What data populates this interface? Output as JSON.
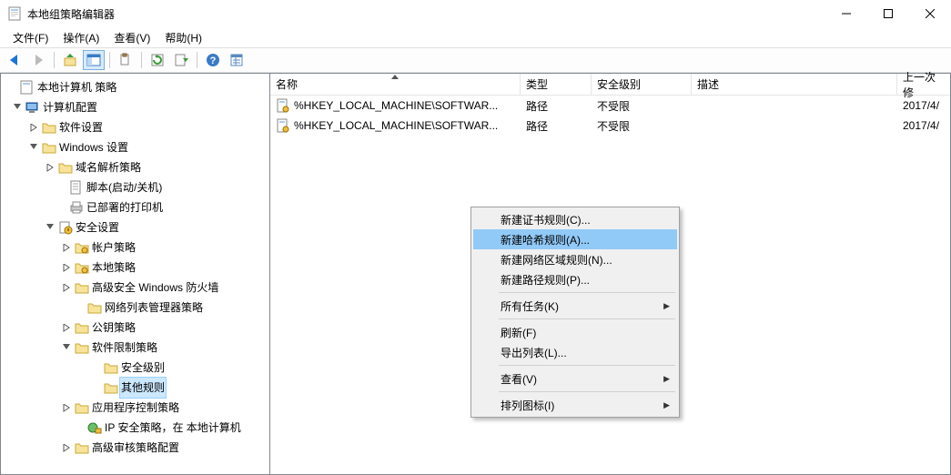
{
  "window": {
    "title": "本地组策略编辑器"
  },
  "menu": {
    "file": "文件(F)",
    "action": "操作(A)",
    "view": "查看(V)",
    "help": "帮助(H)"
  },
  "tree": {
    "root": "本地计算机 策略",
    "computer_config": "计算机配置",
    "software_settings": "软件设置",
    "windows_settings": "Windows 设置",
    "nrp": "域名解析策略",
    "scripts": "脚本(启动/关机)",
    "printers": "已部署的打印机",
    "security_settings": "安全设置",
    "account_policies": "帐户策略",
    "local_policies": "本地策略",
    "adv_firewall": "高级安全 Windows 防火墙",
    "netlist": "网络列表管理器策略",
    "public_key": "公钥策略",
    "srp": "软件限制策略",
    "sec_levels": "安全级别",
    "other_rules": "其他规则",
    "app_control": "应用程序控制策略",
    "ipsec": "IP 安全策略，在 本地计算机",
    "adv_audit": "高级审核策略配置"
  },
  "columns": {
    "name": "名称",
    "type": "类型",
    "security_level": "安全级别",
    "description": "描述",
    "last_modified": "上一次修"
  },
  "column_widths": {
    "name": 275,
    "type": 78,
    "security_level": 110,
    "description": 226,
    "last_modified": 55
  },
  "rows": [
    {
      "name": "%HKEY_LOCAL_MACHINE\\SOFTWAR...",
      "type": "路径",
      "level": "不受限",
      "desc": "",
      "date": "2017/4/"
    },
    {
      "name": "%HKEY_LOCAL_MACHINE\\SOFTWAR...",
      "type": "路径",
      "level": "不受限",
      "desc": "",
      "date": "2017/4/"
    }
  ],
  "context_menu": {
    "cert_rule": "新建证书规则(C)...",
    "hash_rule": "新建哈希规则(A)...",
    "netzone_rule": "新建网络区域规则(N)...",
    "path_rule": "新建路径规则(P)...",
    "all_tasks": "所有任务(K)",
    "refresh": "刷新(F)",
    "export_list": "导出列表(L)...",
    "view": "查看(V)",
    "arrange_icons": "排列图标(I)"
  }
}
